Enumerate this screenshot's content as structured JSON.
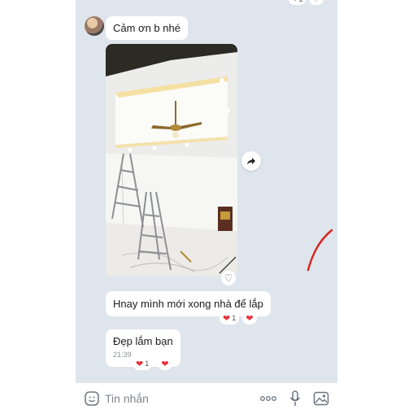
{
  "messages": [
    {
      "text": "Cảm ơn b nhé"
    },
    {
      "text": "Hnay mình mới xong nhà để lắp"
    },
    {
      "text": "Đẹp lắm bạn",
      "time": "21:39"
    }
  ],
  "reactions": {
    "count_top": "1",
    "count_msg2": "1",
    "count_msg3": "1"
  },
  "input": {
    "placeholder": "Tin nhắn"
  },
  "icons": {
    "emoji": "emoji-icon",
    "more": "more-options-icon",
    "mic": "microphone-icon",
    "image": "image-icon",
    "share": "share-icon",
    "heart": "heart-icon"
  },
  "colors": {
    "chat_bg": "#dfe5ec",
    "heart": "#e8323c",
    "icon": "#6b7580"
  }
}
